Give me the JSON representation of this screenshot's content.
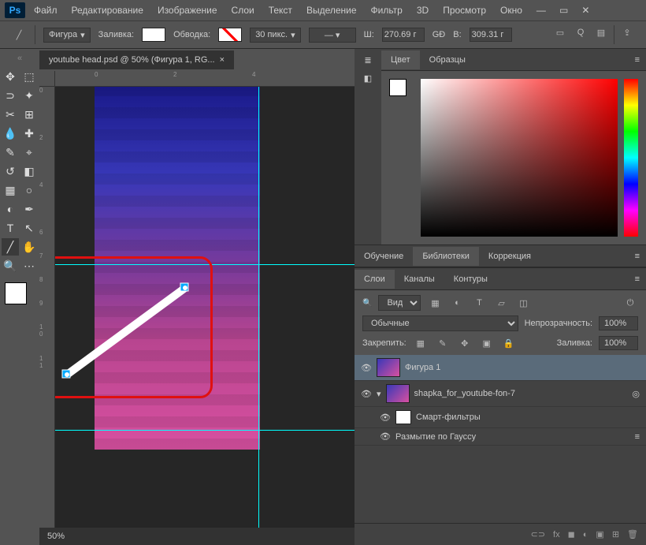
{
  "menu": {
    "file": "Файл",
    "edit": "Редактирование",
    "image": "Изображение",
    "layer": "Слои",
    "type": "Текст",
    "select": "Выделение",
    "filter": "Фильтр",
    "threeD": "3D",
    "view": "Просмотр",
    "window": "Окно"
  },
  "options": {
    "mode": "Фигура",
    "fill_label": "Заливка:",
    "stroke_label": "Обводка:",
    "stroke_width": "30 пикс.",
    "w_label": "Ш:",
    "w_val": "270.69 г",
    "h_label": "В:",
    "h_val": "309.31 г",
    "link": "GĐ"
  },
  "doc": {
    "tab": "youtube head.psd @ 50% (Фигура 1, RG...",
    "close": "×",
    "zoom": "50%"
  },
  "tooltips": {
    "move": "↖",
    "marquee": "⬚",
    "lasso": "⊃",
    "wand": "✦",
    "crop": "⊡",
    "slice": "✂",
    "eyedrop": "💧",
    "ruler": "📏",
    "brush": "✎",
    "stamp": "⌖",
    "eraser": "⌫",
    "grad": "▦",
    "pen": "✒",
    "type": "T",
    "path": "⬠",
    "line": "╱",
    "hand": "✋",
    "zoom": "🔍"
  },
  "panels": {
    "color_tab": "Цвет",
    "swatches_tab": "Образцы",
    "learn_tab": "Обучение",
    "libraries_tab": "Библиотеки",
    "adjust_tab": "Коррекция",
    "layers_tab": "Слои",
    "channels_tab": "Каналы",
    "paths_tab": "Контуры"
  },
  "layers": {
    "search_label": "Вид",
    "blend": "Обычные",
    "opacity_label": "Непрозрачность:",
    "opacity": "100%",
    "lock_label": "Закрепить:",
    "fill_label": "Заливка:",
    "fill": "100%",
    "items": [
      {
        "name": "Фигура 1"
      },
      {
        "name": "shapka_for_youtube-fon-7"
      },
      {
        "name": "Смарт-фильтры"
      },
      {
        "name": "Размытие по Гауссу"
      }
    ]
  }
}
